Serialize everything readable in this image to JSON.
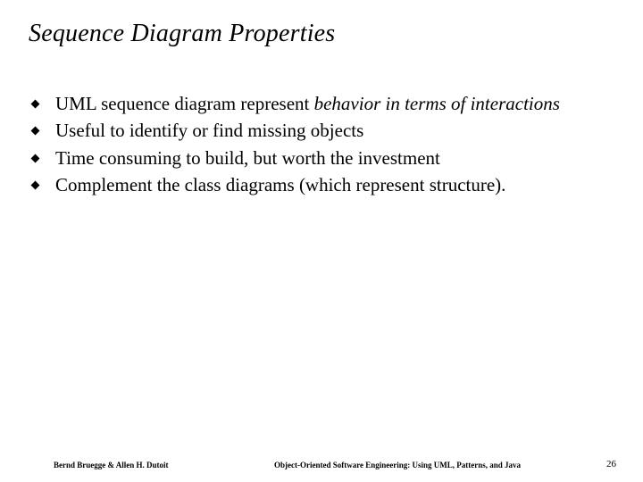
{
  "title": "Sequence Diagram Properties",
  "bullets": [
    {
      "pre": "UML sequence diagram represent ",
      "em": "behavior in terms of interactions",
      "post": ""
    },
    {
      "pre": "Useful to identify or find missing objects",
      "em": "",
      "post": ""
    },
    {
      "pre": "Time consuming to build, but worth the investment",
      "em": "",
      "post": ""
    },
    {
      "pre": "Complement the class diagrams (which represent structure).",
      "em": "",
      "post": ""
    }
  ],
  "footer": {
    "left": "Bernd Bruegge & Allen H. Dutoit",
    "center": "Object-Oriented Software Engineering: Using UML, Patterns, and Java",
    "page": "26"
  }
}
